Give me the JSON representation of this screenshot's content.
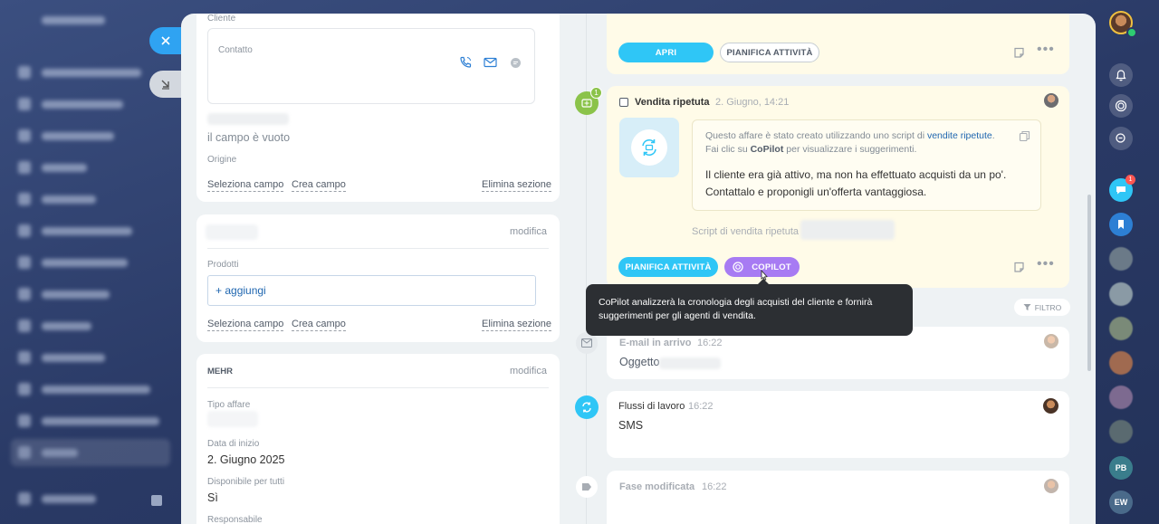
{
  "left": {
    "client_card": {
      "client_label": "Cliente",
      "contact_label": "Contatto",
      "empty_field_text": "il campo è vuoto",
      "origin_label": "Origine",
      "select_field": "Seleziona campo",
      "create_field": "Crea campo",
      "delete_section": "Elimina sezione"
    },
    "products_card": {
      "edit": "modifica",
      "products_label": "Prodotti",
      "add": "+ aggiungi",
      "select_field": "Seleziona campo",
      "create_field": "Crea campo",
      "delete_section": "Elimina sezione"
    },
    "more_card": {
      "title": "MEHR",
      "edit": "modifica",
      "deal_type_label": "Tipo affare",
      "start_date_label": "Data di inizio",
      "start_date_value": "2. Giugno 2025",
      "available_label": "Disponibile per tutti",
      "available_value": "Sì",
      "responsible_label": "Responsabile"
    }
  },
  "timeline": {
    "top_card": {
      "open": "APRI",
      "plan": "PIANIFICA ATTIVITÀ"
    },
    "repeat_card": {
      "badge": "1",
      "title": "Vendita ripetuta",
      "date": "2. Giugno, 14:21",
      "info_line1_prefix": "Questo affare è stato creato utilizzando uno script di ",
      "info_link": "vendite ripetute",
      "info_line1_suffix": ".",
      "info_line2_prefix": "Fai clic su ",
      "info_line2_bold": "CoPilot",
      "info_line2_suffix": " per visualizzare i suggerimenti.",
      "message_line1": "Il cliente era già attivo, ma non ha effettuato acquisti da un po'.",
      "message_line2": "Contattalo e proponigli un'offerta vantaggiosa.",
      "script_label": "Script di vendita ripetuta",
      "plan": "PIANIFICA ATTIVITÀ",
      "copilot": "COPILOT"
    },
    "tooltip": {
      "line1": "CoPilot analizzerà la cronologia degli acquisti del cliente e fornirà",
      "line2": "suggerimenti per gli agenti di vendita."
    },
    "filter": "FILTRO",
    "email_card": {
      "title": "E-mail in arrivo",
      "time": "16:22",
      "subject_label": "Oggetto"
    },
    "flows_card": {
      "title": "Flussi di lavoro",
      "time": "16:22",
      "body": "SMS"
    },
    "stage_card": {
      "title": "Fase modificata",
      "time": "16:22"
    }
  },
  "rail": {
    "chat_badge": "1",
    "initials_1": "PB",
    "initials_2": "EW"
  },
  "colors": {
    "accent_blue": "#2fa3f2",
    "copilot_purple": "#a77bf3",
    "green": "#8bc34a",
    "yellow_card": "#fffbe8"
  }
}
